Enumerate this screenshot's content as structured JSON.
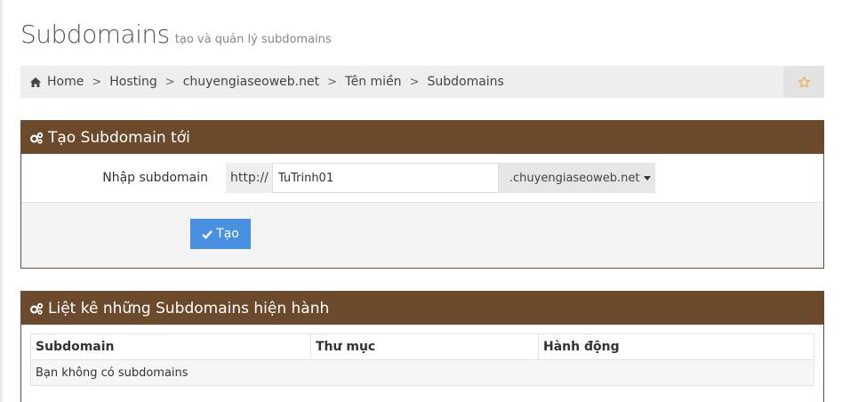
{
  "header": {
    "title": "Subdomains",
    "subtitle": "tạo và quản lý subdomains"
  },
  "breadcrumb": {
    "items": [
      "Home",
      "Hosting",
      "chuyengiaseoweb.net",
      "Tên miền",
      "Subdomains"
    ],
    "separator": ">"
  },
  "create_panel": {
    "title": "Tạo Subdomain tới",
    "label": "Nhập subdomain",
    "prefix": "http://",
    "input_value": "TuTrinh01",
    "domain_selected": ".chuyengiaseoweb.net",
    "button_label": "Tạo"
  },
  "list_panel": {
    "title": "Liệt kê những Subdomains hiện hành",
    "columns": [
      "Subdomain",
      "Thư mục",
      "Hành động"
    ],
    "empty_message": "Bạn không có subdomains"
  },
  "icons": {
    "home": "home-icon",
    "star": "star-icon",
    "cogs": "cogs-icon",
    "check": "check-icon"
  },
  "colors": {
    "panel_header": "#6b4a2b",
    "button": "#4a90e2",
    "star": "#f0ad4e"
  }
}
